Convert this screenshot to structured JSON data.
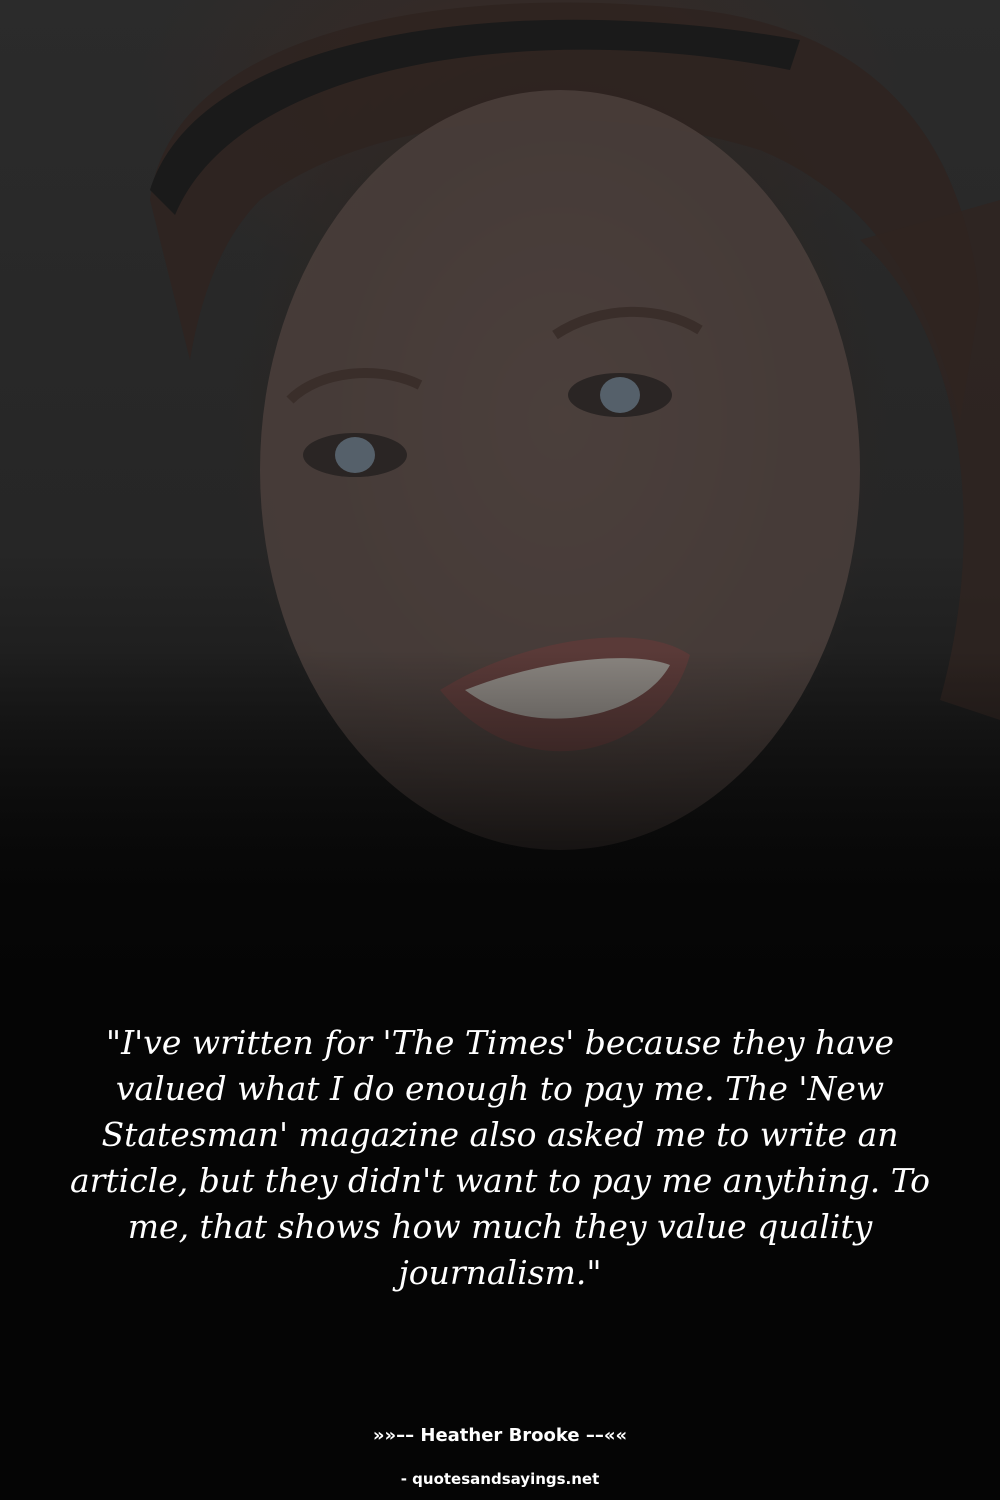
{
  "photo": {
    "subject": "smiling woman portrait",
    "overlay_color": "#000000"
  },
  "quote": {
    "text": "\"I've written for 'The Times' because they have valued what I do enough to pay me. The 'New Statesman' magazine also asked me to write an article, but they didn't want to pay me anything. To me, that shows how much they value quality journalism.\""
  },
  "author": {
    "line": "»»–– Heather Brooke ––««"
  },
  "footer": {
    "source": "- quotesandsayings.net"
  },
  "colors": {
    "text": "#ffffff",
    "background": "#050505"
  }
}
